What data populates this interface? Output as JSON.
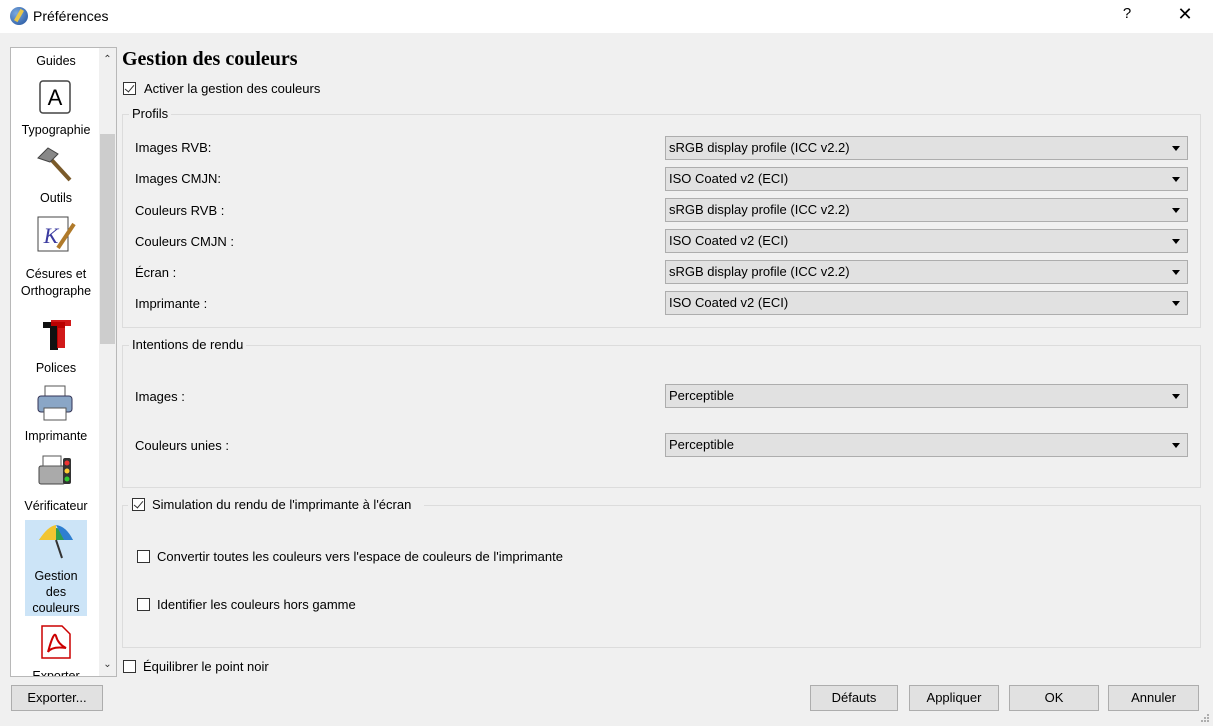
{
  "window": {
    "title": "Préférences",
    "help": "?",
    "close": "✕"
  },
  "sidebar": {
    "items": [
      {
        "label": "Guides",
        "icon": "guides-icon"
      },
      {
        "label": "Typographie",
        "icon": "typography-icon"
      },
      {
        "label": "Outils",
        "icon": "hammer-icon"
      },
      {
        "label": "Césures et Orthographe",
        "label1": "Césures et",
        "label2": "Orthographe",
        "icon": "hyphenation-icon"
      },
      {
        "label": "Polices",
        "icon": "fonts-icon"
      },
      {
        "label": "Imprimante",
        "icon": "printer-icon"
      },
      {
        "label": "Vérificateur",
        "icon": "preflight-verifier-icon"
      },
      {
        "label": "Gestion des couleurs",
        "label1": "Gestion",
        "label2": "des",
        "label3": "couleurs",
        "icon": "umbrella-icon",
        "selected": true
      },
      {
        "label": "Exporter",
        "icon": "pdf-export-icon"
      }
    ]
  },
  "main": {
    "title": "Gestion des couleurs",
    "enable_cm": {
      "label": "Activer la gestion des couleurs",
      "checked": true
    },
    "profiles": {
      "title": "Profils",
      "rows": [
        {
          "label": "Images RVB:",
          "value": "sRGB display profile (ICC v2.2)"
        },
        {
          "label": "Images CMJN:",
          "value": "ISO Coated v2 (ECI)"
        },
        {
          "label": "Couleurs RVB :",
          "value": "sRGB display profile (ICC v2.2)"
        },
        {
          "label": "Couleurs CMJN :",
          "value": "ISO Coated v2 (ECI)"
        },
        {
          "label": "Écran :",
          "value": "sRGB display profile (ICC v2.2)"
        },
        {
          "label": "Imprimante :",
          "value": "ISO Coated v2 (ECI)"
        }
      ]
    },
    "intents": {
      "title": "Intentions de rendu",
      "rows": [
        {
          "label": "Images :",
          "value": "Perceptible"
        },
        {
          "label": "Couleurs unies :",
          "value": "Perceptible"
        }
      ]
    },
    "simulation": {
      "label": "Simulation du rendu de l'imprimante à l'écran",
      "checked": true,
      "convert": {
        "label": "Convertir toutes les couleurs vers l'espace de couleurs de l'imprimante",
        "checked": false
      },
      "gamut": {
        "label": "Identifier les couleurs hors gamme",
        "checked": false
      }
    },
    "black_point": {
      "label": "Équilibrer le point noir",
      "checked": false
    }
  },
  "footer": {
    "export": "Exporter...",
    "defaults": "Défauts",
    "apply": "Appliquer",
    "ok": "OK",
    "cancel": "Annuler"
  }
}
